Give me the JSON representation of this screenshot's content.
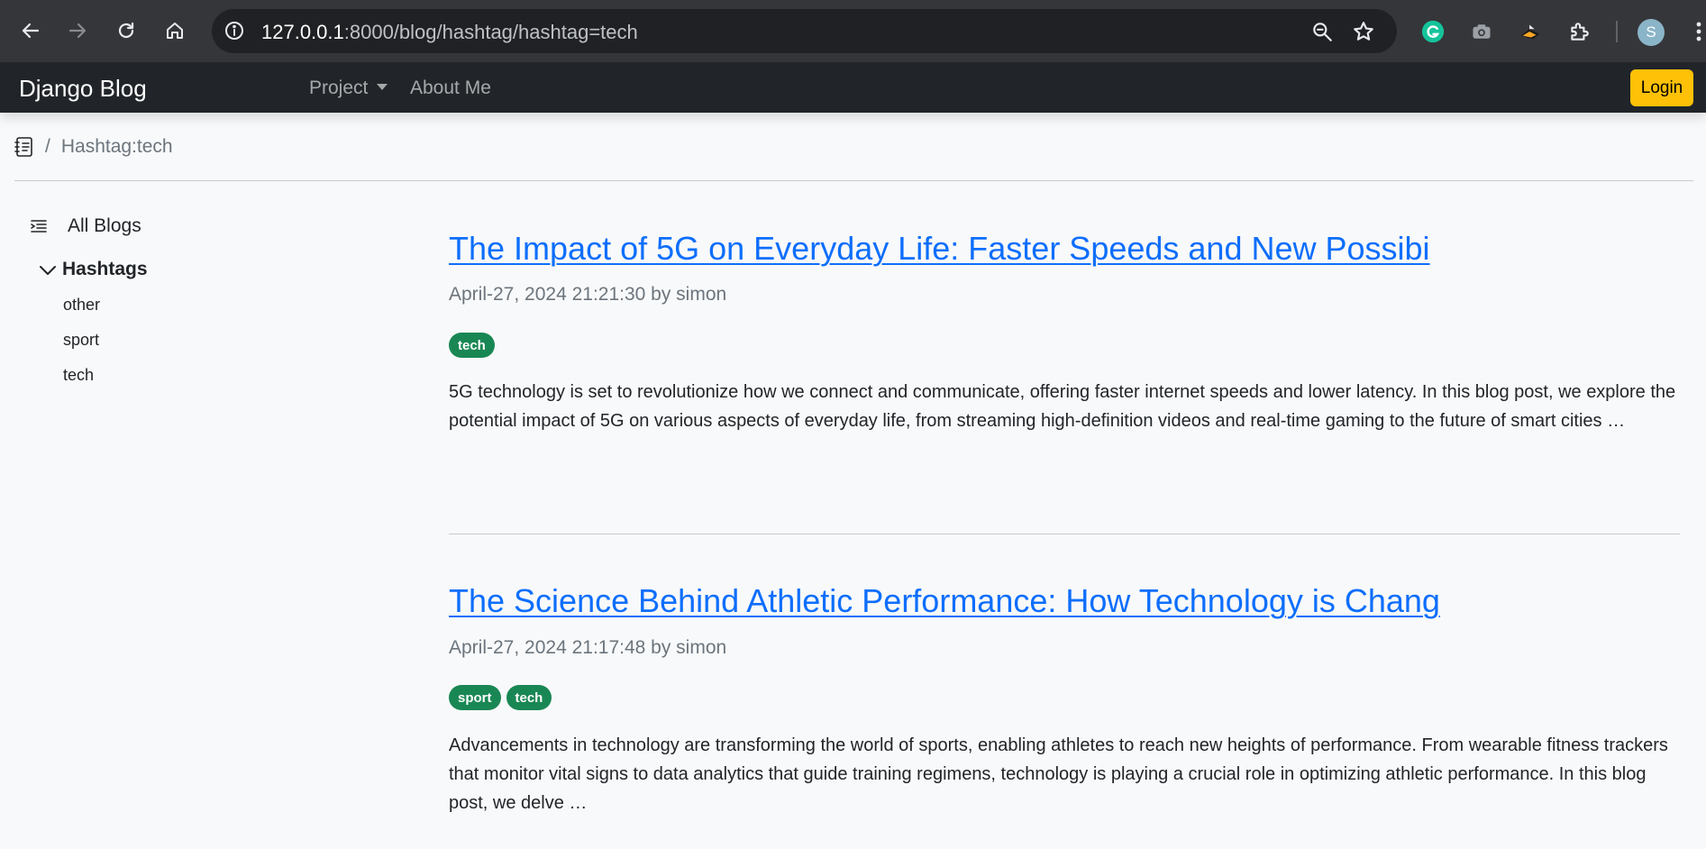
{
  "browser": {
    "url_host": "127.0.0.1",
    "url_path": ":8000/blog/hashtag/hashtag=tech",
    "profile_initial": "S"
  },
  "navbar": {
    "brand": "Django Blog",
    "project_label": "Project",
    "about_label": "About Me",
    "login_label": "Login"
  },
  "breadcrumb": {
    "separator": "/",
    "current": "Hashtag:tech"
  },
  "sidebar": {
    "all_blogs": "All Blogs",
    "hashtags_title": "Hashtags",
    "tags": [
      "other",
      "sport",
      "tech"
    ]
  },
  "posts": [
    {
      "title": "The Impact of 5G on Everyday Life: Faster Speeds and New Possibi",
      "meta": "April-27, 2024 21:21:30 by simon",
      "tags": [
        "tech"
      ],
      "excerpt": "5G technology is set to revolutionize how we connect and communicate, offering faster internet speeds and lower latency. In this blog post, we explore the potential impact of 5G on various aspects of everyday life, from streaming high-definition videos and real-time gaming to the future of smart cities …"
    },
    {
      "title": "The Science Behind Athletic Performance: How Technology is Chang",
      "meta": "April-27, 2024 21:17:48 by simon",
      "tags": [
        "sport",
        "tech"
      ],
      "excerpt": "Advancements in technology are transforming the world of sports, enabling athletes to reach new heights of performance. From wearable fitness trackers that monitor vital signs to data analytics that guide training regimens, technology is playing a crucial role in optimizing athletic performance. In this blog post, we delve …"
    }
  ],
  "colors": {
    "accent": "#0d6efd",
    "tag_badge": "#198754",
    "login_button": "#ffc107",
    "navbar": "#212529"
  }
}
